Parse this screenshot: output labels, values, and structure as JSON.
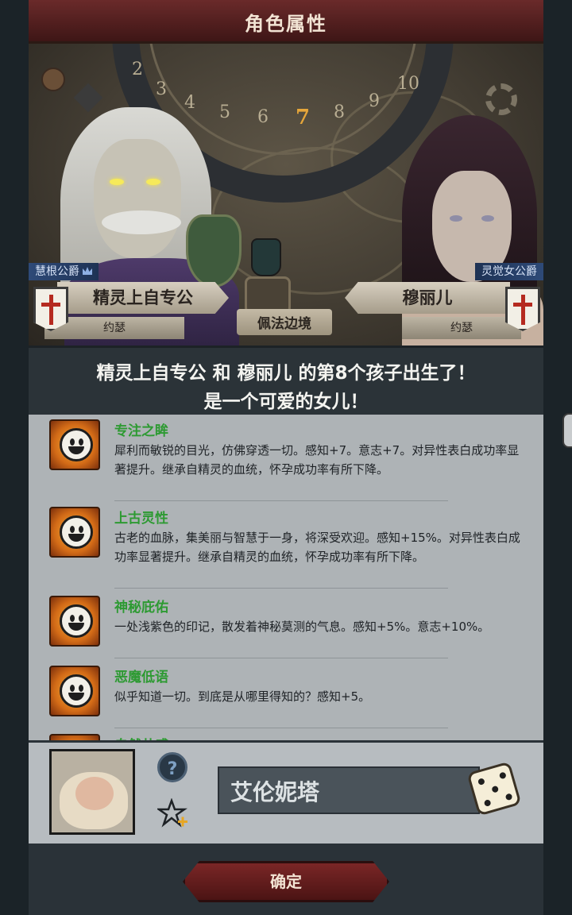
{
  "header": {
    "title": "角色属性"
  },
  "scene": {
    "dial_numbers": [
      "2",
      "3",
      "4",
      "5",
      "6",
      "7",
      "8",
      "9",
      "10"
    ],
    "dial_highlight": "7",
    "region": "佩法边境"
  },
  "parents": {
    "father": {
      "title": "慧根公爵",
      "name": "精灵上自专公",
      "faith": "约瑟"
    },
    "mother": {
      "title": "灵觉女公爵",
      "name": "穆丽儿",
      "faith": "约瑟"
    }
  },
  "announcement": {
    "line1": "精灵上自专公 和 穆丽儿 的第8个孩子出生了！",
    "line2": "是一个可爱的女儿！"
  },
  "traits": [
    {
      "name": "专注之眸",
      "desc": "犀利而敏锐的目光，仿佛穿透一切。感知+7。意志+7。对异性表白成功率显著提升。继承自精灵的血统，怀孕成功率有所下降。"
    },
    {
      "name": "上古灵性",
      "desc": "古老的血脉，集美丽与智慧于一身，将深受欢迎。感知+15%。对异性表白成功率显著提升。继承自精灵的血统，怀孕成功率有所下降。"
    },
    {
      "name": "神秘庇佑",
      "desc": "一处浅紫色的印记，散发着神秘莫测的气息。感知+5%。意志+10%。"
    },
    {
      "name": "恶魔低语",
      "desc": "似乎知道一切。到底是从哪里得知的？感知+5。"
    },
    {
      "name": "自然共感",
      "desc": ""
    }
  ],
  "child": {
    "name_value": "艾伦妮塔",
    "help_label": "?"
  },
  "confirm_label": "确定",
  "colors": {
    "accent_red": "#6a2a2a",
    "trait_green": "#2d9a32",
    "title_blue": "#2e4a78"
  },
  "icons": [
    "smile-icon",
    "help-icon",
    "star-add-icon",
    "dice-icon",
    "gear-icon",
    "cross-flag-icon",
    "shield-icon"
  ]
}
